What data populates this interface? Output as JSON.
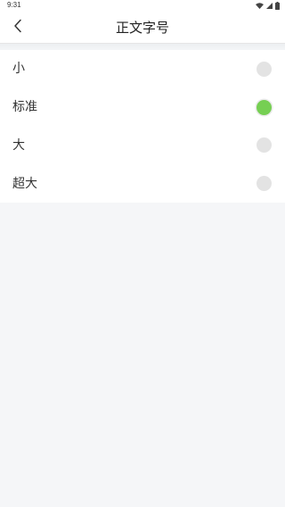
{
  "status_bar": {
    "time": "9:31",
    "icons": [
      "wifi-icon",
      "signal-icon",
      "battery-icon"
    ]
  },
  "header": {
    "title": "正文字号",
    "back_icon": "chevron-left-icon"
  },
  "options": [
    {
      "label": "小",
      "selected": false
    },
    {
      "label": "标准",
      "selected": true
    },
    {
      "label": "大",
      "selected": false
    },
    {
      "label": "超大",
      "selected": false
    }
  ],
  "colors": {
    "selected": "#76cf53",
    "unselected": "#e3e3e3",
    "background": "#f5f6f8"
  }
}
